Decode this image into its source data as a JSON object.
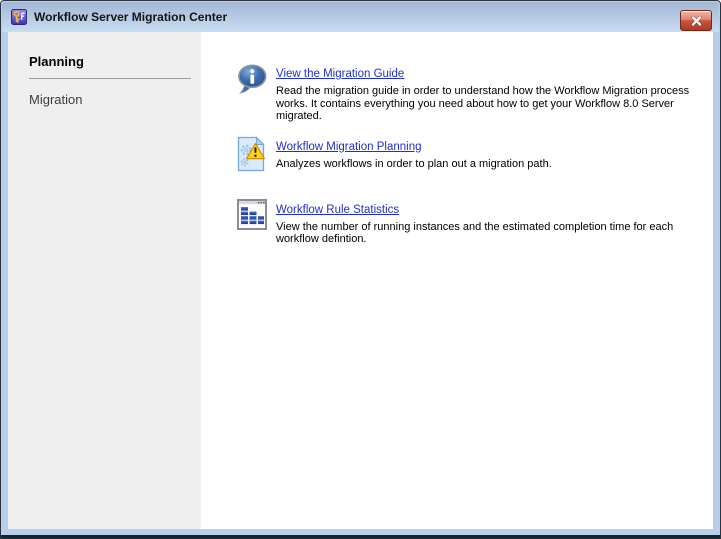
{
  "window": {
    "title": "Workflow Server Migration Center",
    "app_icon": "workflow-key-app-icon",
    "close_icon": "close-icon"
  },
  "sidebar": {
    "items": [
      {
        "label": "Planning",
        "active": true
      },
      {
        "label": "Migration",
        "active": false
      }
    ]
  },
  "main": {
    "items": [
      {
        "icon": "info-balloon-icon",
        "link_label": "View the Migration Guide",
        "description": "Read the migration guide in order to understand how the Workflow Migration process works. It contains everything you need about how to get your Workflow 8.0 Server migrated."
      },
      {
        "icon": "workflow-gears-warning-icon",
        "link_label": "Workflow Migration Planning",
        "description": "Analyzes workflows in order to plan out a migration path."
      },
      {
        "icon": "bar-chart-window-icon",
        "link_label": "Workflow Rule Statistics",
        "description": "View the number of running instances and the estimated completion time for each workflow defintion."
      }
    ]
  },
  "colors": {
    "link": "#2030cc",
    "titlebar_top": "#a4b8d5",
    "titlebar_bottom": "#c8dcf2",
    "frame": "#b7cfe8",
    "sidebar_bg": "#efefef",
    "close_button_red": "#cb5640",
    "warning_yellow": "#ffd21c",
    "info_blue": "#3e6cb0",
    "bar_blue": "#2a4fa4"
  }
}
